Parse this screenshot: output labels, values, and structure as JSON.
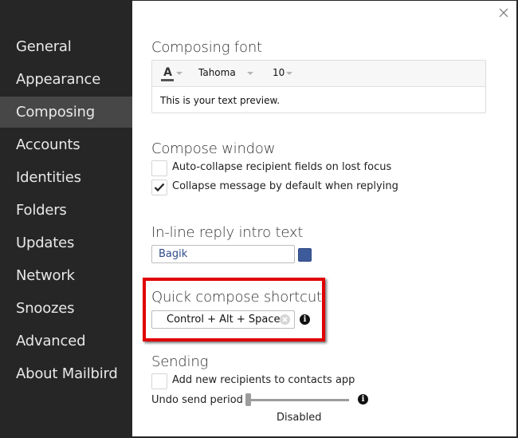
{
  "sidebar": {
    "items": [
      {
        "label": "General",
        "active": false
      },
      {
        "label": "Appearance",
        "active": false
      },
      {
        "label": "Composing",
        "active": true
      },
      {
        "label": "Accounts",
        "active": false
      },
      {
        "label": "Identities",
        "active": false
      },
      {
        "label": "Folders",
        "active": false
      },
      {
        "label": "Updates",
        "active": false
      },
      {
        "label": "Network",
        "active": false
      },
      {
        "label": "Snoozes",
        "active": false
      },
      {
        "label": "Advanced",
        "active": false
      },
      {
        "label": "About Mailbird",
        "active": false
      }
    ]
  },
  "panel": {
    "close_icon": "close-x-icon",
    "composing_font": {
      "title": "Composing font",
      "text_color_icon": "font-color-A-icon",
      "font_family": "Tahoma",
      "font_size": "10",
      "preview": "This is your text preview."
    },
    "compose_window": {
      "title": "Compose window",
      "options": [
        {
          "label": "Auto-collapse recipient fields on lost focus",
          "checked": false
        },
        {
          "label": "Collapse message by default when replying",
          "checked": true
        }
      ]
    },
    "inline_reply": {
      "title": "In-line reply intro text",
      "value": "Bagik",
      "color": "#3d5a9a"
    },
    "quick_compose": {
      "title": "Quick compose shortcut",
      "value": "Control + Alt + Space",
      "highlight_color": "#e00000"
    },
    "sending": {
      "title": "Sending",
      "options": [
        {
          "label": "Add new recipients to contacts app",
          "checked": false
        }
      ],
      "undo_send": {
        "label": "Undo send period",
        "value_label": "Disabled",
        "position": 0
      }
    }
  }
}
